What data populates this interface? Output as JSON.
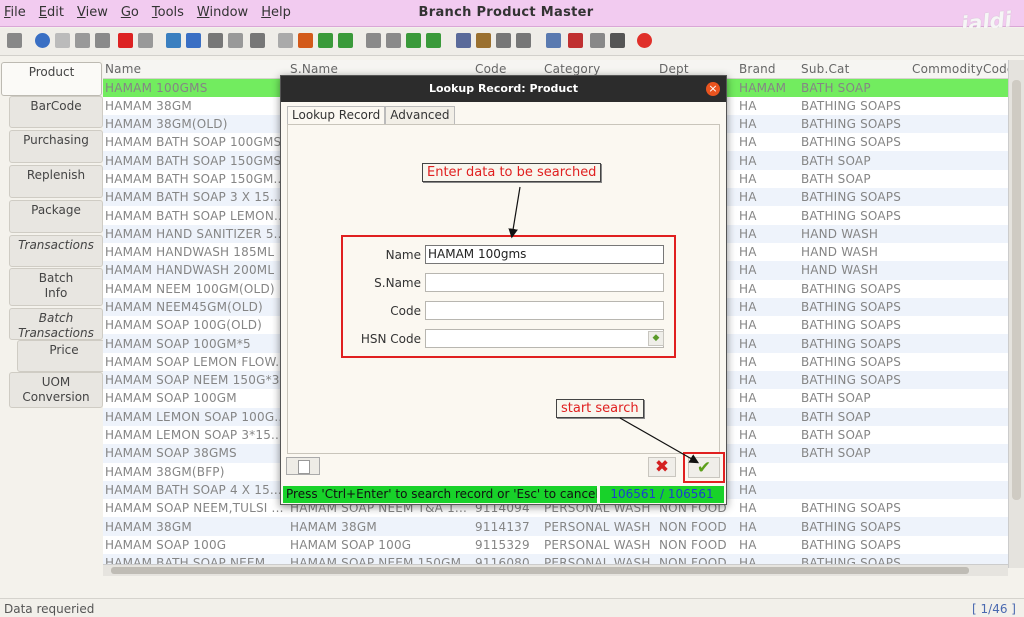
{
  "window": {
    "title": "Branch Product Master",
    "brand": "jaldi"
  },
  "menu": [
    "File",
    "Edit",
    "View",
    "Go",
    "Tools",
    "Window",
    "Help"
  ],
  "toolbar_icons": [
    "undo-icon",
    "help-icon",
    "new-icon",
    "copy-icon",
    "save-icon",
    "delete-icon",
    "print-icon",
    "refresh-icon",
    "find-icon",
    "attach-icon",
    "comment-icon",
    "zoom-icon",
    "stop-icon",
    "home-icon",
    "prev-icon",
    "next-icon",
    "first-icon",
    "up-icon",
    "down-icon",
    "last-icon",
    "report-icon",
    "archive-icon",
    "user-icon",
    "group-icon",
    "zoom-in-icon",
    "workflow-icon",
    "product-icon",
    "settings-icon",
    "close-icon"
  ],
  "side_tabs": [
    {
      "label": "Product"
    },
    {
      "label": "BarCode"
    },
    {
      "label": "Purchasing"
    },
    {
      "label": "Replenish"
    },
    {
      "label": "Package"
    },
    {
      "label": "Transactions"
    },
    {
      "label": "Batch\nInfo"
    },
    {
      "label": "Batch\nTransactions"
    },
    {
      "label": "Price"
    },
    {
      "label": "UOM\nConversion"
    }
  ],
  "grid": {
    "columns": [
      "Name",
      "S.Name",
      "Code",
      "Category",
      "Dept",
      "Brand",
      "Sub.Cat",
      "CommodityCode"
    ],
    "rows": [
      [
        "HAMAM 100GMS",
        "",
        "",
        "",
        "",
        "HAMAM",
        "BATH SOAP",
        ""
      ],
      [
        "HAMAM 38GM",
        "",
        "",
        "",
        "",
        "HA",
        "BATHING SOAPS",
        ""
      ],
      [
        "HAMAM 38GM(OLD)",
        "",
        "",
        "",
        "",
        "HA",
        "BATHING SOAPS",
        ""
      ],
      [
        "HAMAM BATH SOAP 100GMS",
        "",
        "",
        "",
        "",
        "HA",
        "BATHING SOAPS",
        ""
      ],
      [
        "HAMAM BATH SOAP 150GMS",
        "",
        "",
        "",
        "",
        "HA",
        "BATH SOAP",
        ""
      ],
      [
        "HAMAM BATH SOAP 150GM..",
        "",
        "",
        "",
        "",
        "HA",
        "BATH SOAP",
        ""
      ],
      [
        "HAMAM BATH SOAP 3 X 15...",
        "",
        "",
        "",
        "",
        "HA",
        "BATHING SOAPS",
        ""
      ],
      [
        "HAMAM BATH SOAP LEMON...",
        "",
        "",
        "",
        "",
        "HA",
        "BATHING SOAPS",
        ""
      ],
      [
        "HAMAM HAND SANITIZER 5...",
        "",
        "",
        "",
        "",
        "HA",
        "HAND WASH",
        ""
      ],
      [
        "HAMAM HANDWASH 185ML",
        "",
        "",
        "",
        "",
        "HA",
        "HAND WASH",
        ""
      ],
      [
        "HAMAM HANDWASH 200ML",
        "",
        "",
        "",
        "",
        "HA",
        "HAND WASH",
        ""
      ],
      [
        "HAMAM NEEM 100GM(OLD)",
        "",
        "",
        "",
        "",
        "HA",
        "BATHING SOAPS",
        ""
      ],
      [
        "HAMAM NEEM45GM(OLD)",
        "",
        "",
        "",
        "",
        "HA",
        "BATHING SOAPS",
        ""
      ],
      [
        "HAMAM SOAP 100G(OLD)",
        "",
        "",
        "",
        "",
        "HA",
        "BATHING SOAPS",
        ""
      ],
      [
        "HAMAM SOAP 100GM*5",
        "",
        "",
        "",
        "",
        "HA",
        "BATHING SOAPS",
        ""
      ],
      [
        "HAMAM SOAP LEMON FLOW...",
        "",
        "",
        "",
        "",
        "HA",
        "BATHING SOAPS",
        ""
      ],
      [
        "HAMAM SOAP NEEM 150G*3",
        "",
        "",
        "",
        "",
        "HA",
        "BATHING SOAPS",
        ""
      ],
      [
        "HAMAM SOAP 100GM",
        "",
        "",
        "",
        "",
        "HA",
        "BATH SOAP",
        ""
      ],
      [
        "HAMAM LEMON SOAP 100G...",
        "",
        "",
        "",
        "",
        "HA",
        "BATH SOAP",
        ""
      ],
      [
        "HAMAM LEMON SOAP 3*15...",
        "",
        "",
        "",
        "",
        "HA",
        "BATH SOAP",
        ""
      ],
      [
        "HAMAM SOAP 38GMS",
        "",
        "",
        "",
        "",
        "HA",
        "BATH SOAP",
        ""
      ],
      [
        "HAMAM 38GM(BFP)",
        "",
        "",
        "",
        "",
        "HA",
        "",
        ""
      ],
      [
        "HAMAM BATH SOAP 4 X 15...",
        "",
        "",
        "",
        "",
        "HA",
        "",
        ""
      ],
      [
        "HAMAM SOAP NEEM,TULSI ...",
        "HAMAM SOAP NEEM T&A 1...",
        "9114094",
        "PERSONAL WASH",
        "NON FOOD",
        "HA",
        "BATHING SOAPS",
        ""
      ],
      [
        "HAMAM 38GM",
        "HAMAM 38GM",
        "9114137",
        "PERSONAL WASH",
        "NON FOOD",
        "HA",
        "BATHING SOAPS",
        ""
      ],
      [
        "HAMAM SOAP 100G",
        "HAMAM SOAP 100G",
        "9115329",
        "PERSONAL WASH",
        "NON FOOD",
        "HA",
        "BATHING SOAPS",
        ""
      ],
      [
        "HAMAM BATH SOAP NEEM...",
        "HAMAM SOAP NEEM 150GM...",
        "9116080",
        "PERSONAL WASH",
        "NON FOOD",
        "HA",
        "BATHING SOAPS",
        ""
      ]
    ]
  },
  "status": {
    "message": "Data requeried",
    "pager": "[ 1/46 ]"
  },
  "dialog": {
    "title": "Lookup Record: Product",
    "tabs": [
      "Lookup Record",
      "Advanced"
    ],
    "fields": {
      "name": {
        "label": "Name",
        "value": "HAMAM 100gms"
      },
      "sname": {
        "label": "S.Name",
        "value": ""
      },
      "code": {
        "label": "Code",
        "value": ""
      },
      "hsn": {
        "label": "HSN Code",
        "value": ""
      }
    },
    "callout_enter": "Enter data to be searched",
    "callout_start": "start search",
    "hint": "Press 'Ctrl+Enter' to search record or 'Esc' to cancel",
    "count": "106561 / 106561",
    "close_glyph": "×",
    "cancel_glyph": "✖",
    "ok_glyph": "✔"
  }
}
